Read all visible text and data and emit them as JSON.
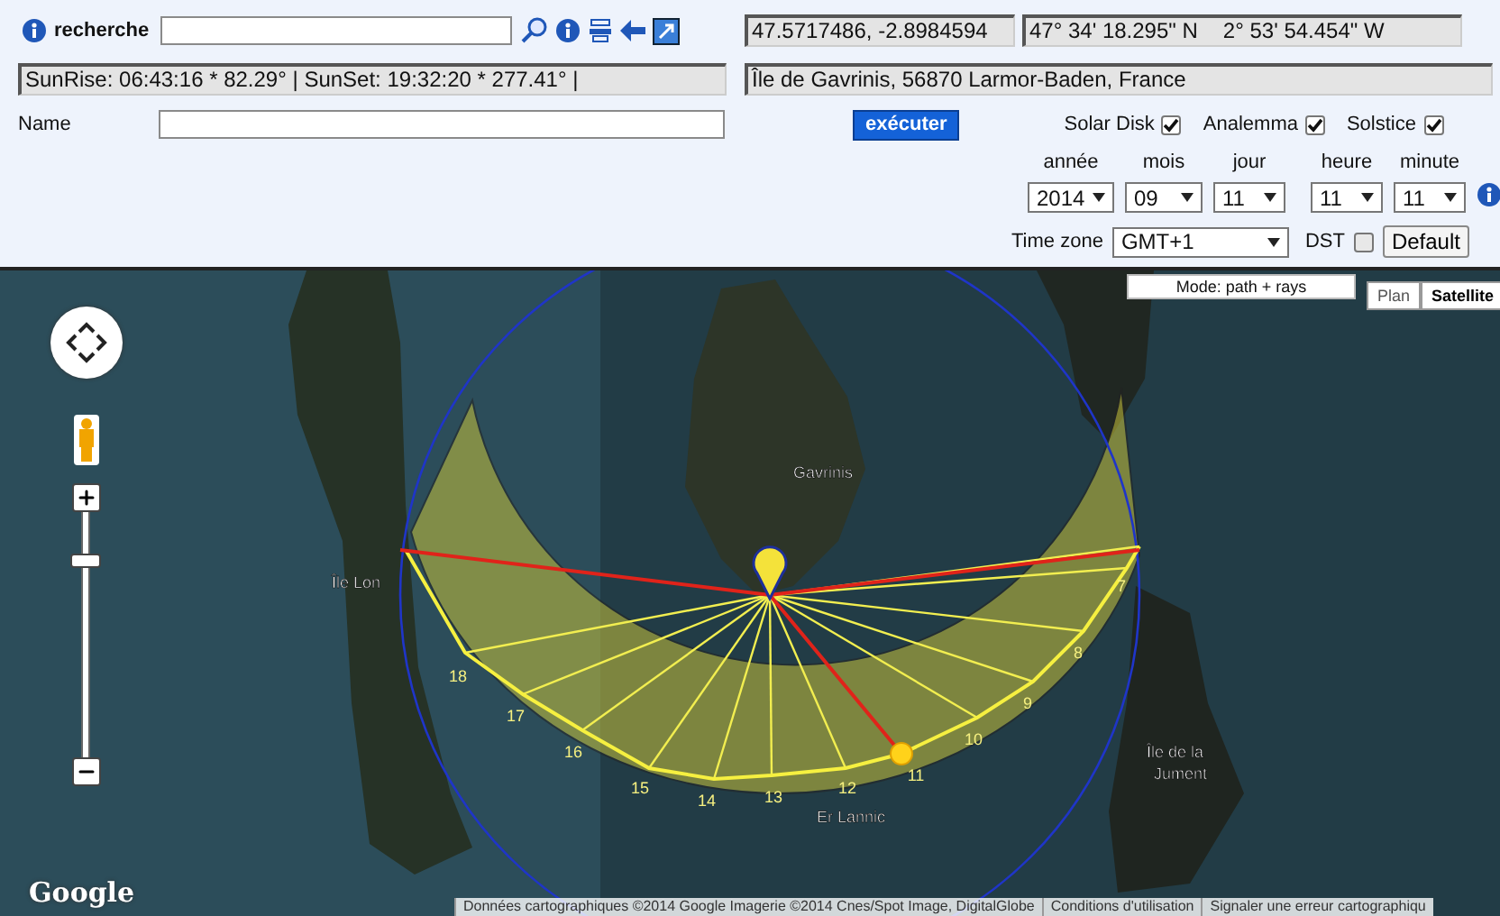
{
  "search": {
    "label": "recherche"
  },
  "coordinates": {
    "decimal": "47.5717486, -2.8984594",
    "dms_lat": "47° 34' 18.295\" N",
    "dms_lon": "2° 53' 54.454\" W"
  },
  "sun_times": "SunRise: 06:43:16 * 82.29° | SunSet: 19:32:20 * 277.41° |",
  "address": "Île de Gavrinis, 56870 Larmor-Baden, France",
  "name_field": {
    "label": "Name"
  },
  "run_button": "exécuter",
  "options": [
    {
      "label": "Solar Disk",
      "checked": true
    },
    {
      "label": "Analemma",
      "checked": true
    },
    {
      "label": "Solstice",
      "checked": true
    }
  ],
  "date_fields": [
    {
      "label": "année",
      "value": "2014"
    },
    {
      "label": "mois",
      "value": "09"
    },
    {
      "label": "jour",
      "value": "11"
    },
    {
      "label": "heure",
      "value": "11"
    },
    {
      "label": "minute",
      "value": "11"
    }
  ],
  "time_zone": {
    "label": "Time zone",
    "value": "GMT+1"
  },
  "dst": {
    "label": "DST",
    "checked": false
  },
  "default_button": "Default",
  "map": {
    "mode": "Mode: path + rays",
    "zoom": {
      "level": 0.82
    },
    "map_types": [
      {
        "label": "Plan",
        "selected": false
      },
      {
        "label": "Satellite",
        "selected": true
      }
    ],
    "place_labels": [
      "Gavrinis",
      "Île Lon",
      "Île de la",
      "Jument",
      "Er Lannic"
    ],
    "hour_labels": [
      "18",
      "17",
      "16",
      "15",
      "14",
      "13",
      "12",
      "11",
      "10",
      "9",
      "8",
      "7"
    ],
    "logo": "Google",
    "attribution": [
      "Données cartographiques ©2014 Google Imagerie ©2014 Cnes/Spot Image, DigitalGlobe",
      "Conditions d'utilisation",
      "Signaler une erreur cartographiqu"
    ]
  }
}
